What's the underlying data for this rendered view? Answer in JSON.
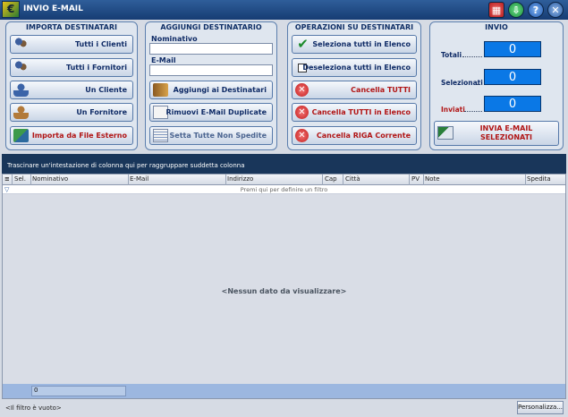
{
  "window": {
    "title": "INVIO E-MAIL"
  },
  "importa": {
    "title": "IMPORTA DESTINATARI",
    "buttons": [
      "Tutti i Clienti",
      "Tutti i Fornitori",
      "Un Cliente",
      "Un Fornitore",
      "Importa da File Esterno"
    ]
  },
  "aggiungi": {
    "title": "AGGIUNGI DESTINATARIO",
    "nominativo_label": "Nominativo",
    "nominativo_value": "",
    "email_label": "E-Mail",
    "email_value": "",
    "buttons": [
      "Aggiungi ai Destinatari",
      "Rimuovi E-Mail Duplicate",
      "Setta Tutte Non Spedite"
    ]
  },
  "operazioni": {
    "title": "OPERAZIONI SU DESTINATARI",
    "buttons": [
      "Seleziona tutti in Elenco",
      "Deseleziona tutti in Elenco",
      "Cancella TUTTI",
      "Cancella TUTTI in Elenco",
      "Cancella RIGA Corrente"
    ]
  },
  "invio": {
    "title": "INVIO",
    "totali_label": "Totali",
    "totali_value": "0",
    "selezionati_label": "Selezionati",
    "selezionati_value": "0",
    "inviati_label": "Inviati",
    "inviati_value": "0",
    "send_button": "INVIA E-MAIL SELEZIONATI"
  },
  "grid": {
    "group_hint": "Trascinare un'intestazione di colonna qui per raggruppare suddetta colonna",
    "columns": [
      "Sel.",
      "Nominativo",
      "E-Mail",
      "Indirizzo",
      "Cap",
      "Città",
      "PV",
      "Note",
      "Spedita"
    ],
    "filter_hint": "Premi qui per definire un filtro",
    "empty": "<Nessun dato da visualizzare>",
    "count": "0"
  },
  "status": {
    "filter_text": "<Il filtro è vuoto>",
    "customize_button": "Personalizza..."
  },
  "colors": {
    "titlebar": "#1f4a86",
    "stat_box": "#0a78e6",
    "danger_text": "#b11515",
    "grid_header": "#19365a"
  }
}
